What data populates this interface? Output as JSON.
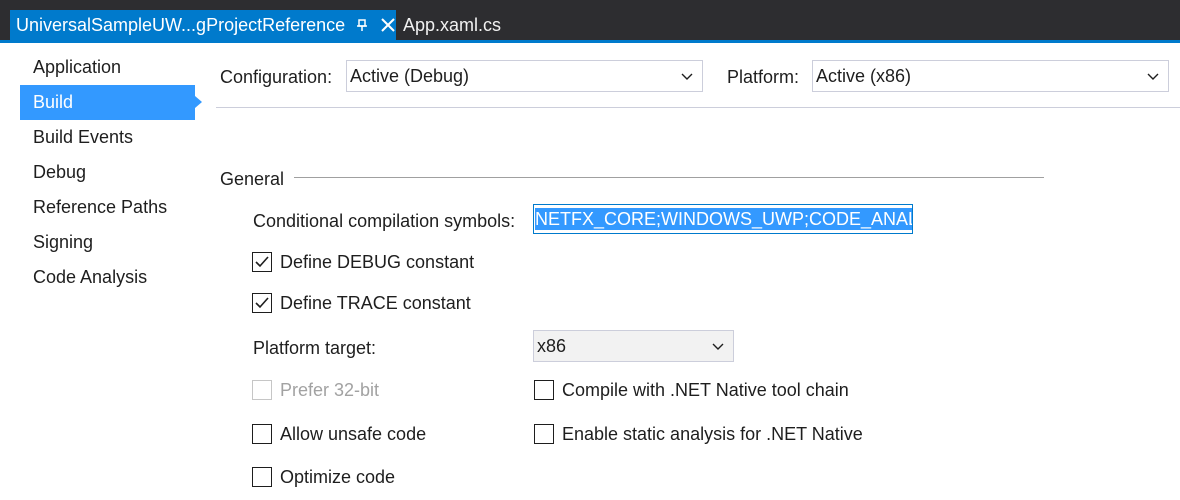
{
  "tabs": {
    "active_title": "UniversalSampleUW...gProjectReference",
    "inactive_title": "App.xaml.cs"
  },
  "nav": {
    "items": [
      {
        "label": "Application"
      },
      {
        "label": "Build"
      },
      {
        "label": "Build Events"
      },
      {
        "label": "Debug"
      },
      {
        "label": "Reference Paths"
      },
      {
        "label": "Signing"
      },
      {
        "label": "Code Analysis"
      }
    ],
    "selected": "Build"
  },
  "config": {
    "configuration_label": "Configuration:",
    "configuration_value": "Active (Debug)",
    "platform_label": "Platform:",
    "platform_value": "Active (x86)"
  },
  "general": {
    "section_title": "General",
    "symbols_label": "Conditional compilation symbols:",
    "symbols_value": "NETFX_CORE;WINDOWS_UWP;CODE_ANALYSIS",
    "define_debug": {
      "label": "Define DEBUG constant",
      "checked": true
    },
    "define_trace": {
      "label": "Define TRACE constant",
      "checked": true
    },
    "platform_target_label": "Platform target:",
    "platform_target_value": "x86",
    "prefer32": {
      "label": "Prefer 32-bit",
      "checked": false,
      "disabled": true
    },
    "native_toolchain": {
      "label": "Compile with .NET Native tool chain",
      "checked": false
    },
    "unsafe_code": {
      "label": "Allow unsafe code",
      "checked": false
    },
    "static_analysis": {
      "label": "Enable static analysis for .NET Native",
      "checked": false
    },
    "optimize": {
      "label": "Optimize code",
      "checked": false
    }
  },
  "colors": {
    "accent": "#007acc",
    "selection": "#3399ff",
    "tabstrip": "#2d2d30"
  }
}
